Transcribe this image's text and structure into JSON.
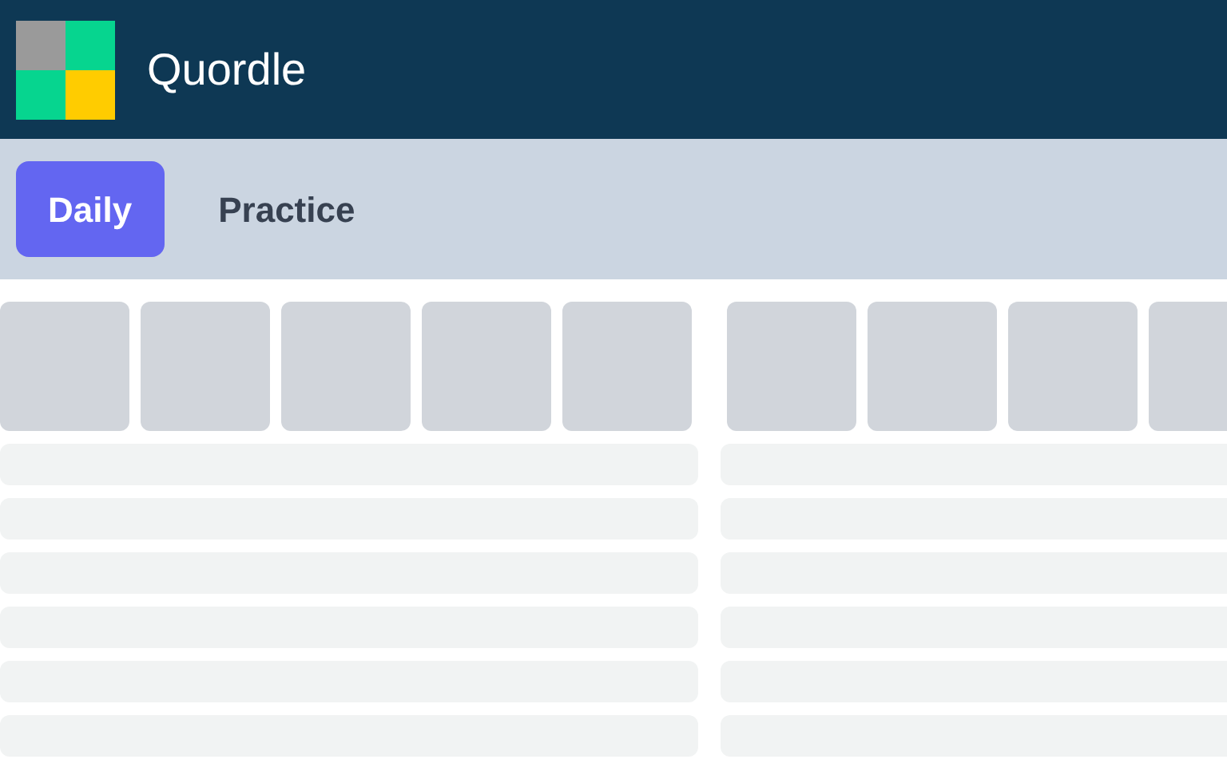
{
  "header": {
    "title": "Quordle"
  },
  "tabs": [
    {
      "label": "Daily",
      "selected": true
    },
    {
      "label": "Practice",
      "selected": false
    }
  ]
}
